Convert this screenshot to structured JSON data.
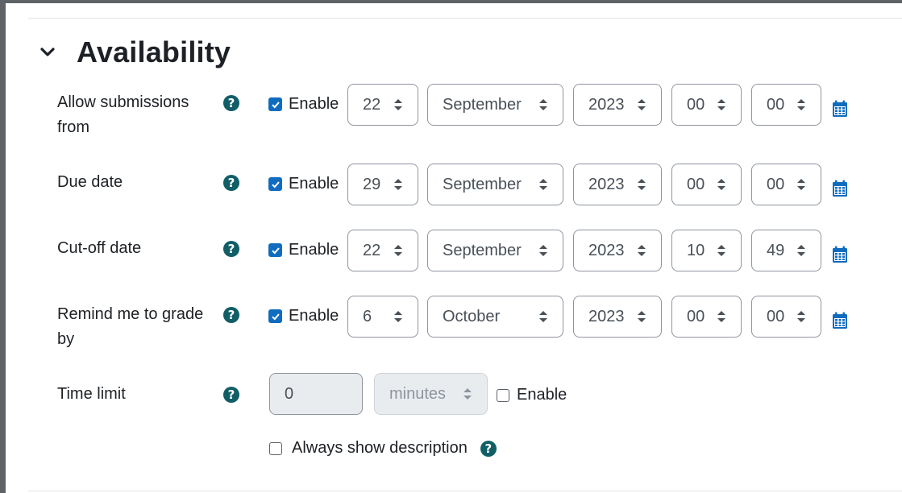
{
  "section": {
    "title": "Availability",
    "icon": "chevron-down-icon"
  },
  "colors": {
    "accent": "#0f6cbf",
    "help_icon": "#115e67",
    "text": "#1d2125",
    "border": "#8f959e",
    "disabled_bg": "#e9ecef"
  },
  "help_symbol": "?",
  "rows": [
    {
      "label": "Allow submissions from",
      "label_line1": "Allow submissions",
      "label_line2": "from",
      "enable_label": "Enable",
      "enabled": true,
      "day": "22",
      "month": "September",
      "year": "2023",
      "hour": "00",
      "minute": "00"
    },
    {
      "label": "Due date",
      "enable_label": "Enable",
      "enabled": true,
      "day": "29",
      "month": "September",
      "year": "2023",
      "hour": "00",
      "minute": "00"
    },
    {
      "label": "Cut-off date",
      "enable_label": "Enable",
      "enabled": true,
      "day": "22",
      "month": "September",
      "year": "2023",
      "hour": "10",
      "minute": "49"
    },
    {
      "label": "Remind me to grade by",
      "label_line1": "Remind me to grade",
      "label_line2": "by",
      "enable_label": "Enable",
      "enabled": true,
      "day": "6",
      "month": "October",
      "year": "2023",
      "hour": "00",
      "minute": "00"
    }
  ],
  "time_limit": {
    "label": "Time limit",
    "value": "0",
    "unit": "minutes",
    "enable_label": "Enable",
    "enabled": false
  },
  "always_show": {
    "label": "Always show description",
    "checked": false
  }
}
